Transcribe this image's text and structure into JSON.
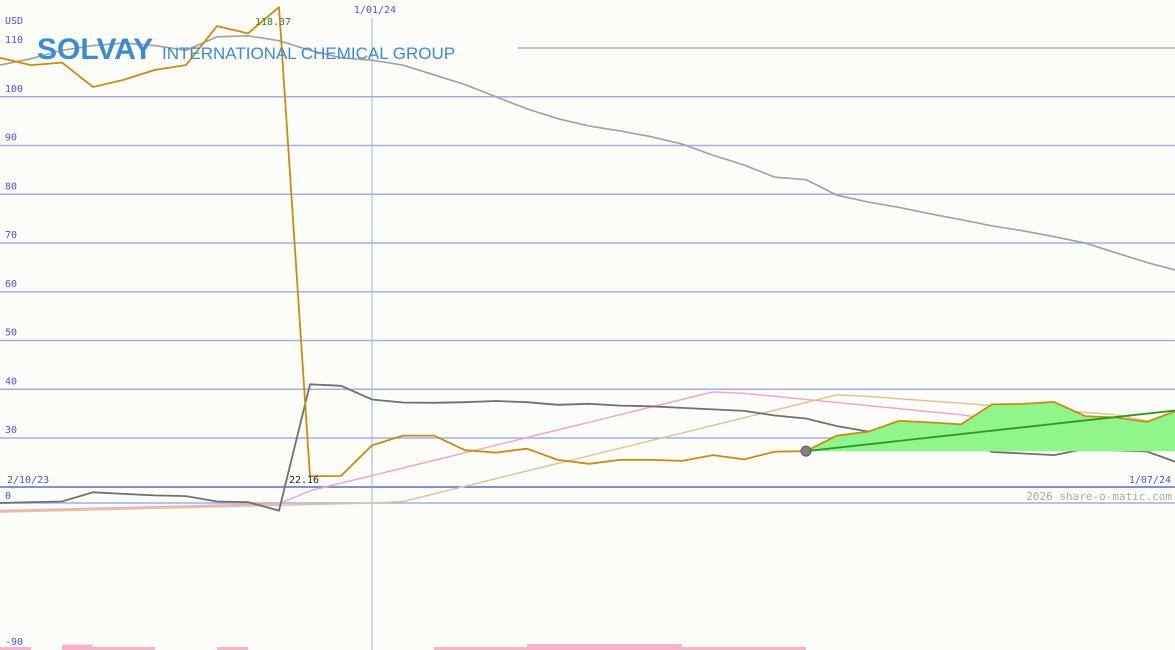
{
  "header": {
    "company": "SOLVAY",
    "subtitle": "INTERNATIONAL CHEMICAL GROUP",
    "currency": "USD",
    "credit": "2026 share-o-matic.com"
  },
  "colors": {
    "background": "#fcfdf8",
    "grid": "#9fb0e6",
    "price": "#cc8a14",
    "average": "#a0a0a0",
    "trend": "#2a9a22",
    "trend_fill": "#90f58a",
    "indicator": "#707070",
    "indicator_pink": "#f0a8c0",
    "indicator_tan": "#e0c498",
    "volume": "#f7b3ca"
  },
  "chart_data": [
    {
      "type": "line",
      "name": "price-panel",
      "ylim": [
        22,
        119
      ],
      "yticks": [
        30,
        40,
        50,
        60,
        70,
        80,
        90,
        100,
        110
      ],
      "x_start_label": "2/10/23",
      "x_end_label": "1/07/24",
      "x_marker_label": "1/01/24",
      "x_marker_index": 12,
      "peak_label": "118.37",
      "peak_index": 9,
      "trough_label": "22.16",
      "trough_index": 10,
      "series": [
        {
          "role": "price",
          "values": [
            108,
            106.5,
            107,
            102,
            103.5,
            105.5,
            106.5,
            114.5,
            113,
            118.37,
            22.16,
            22.2,
            28.5,
            30.5,
            30.5,
            27.5,
            27,
            27.8,
            25.5,
            24.7,
            25.5,
            25.5,
            25.3,
            26.5,
            25.6,
            27.2,
            27.3,
            30.5,
            31.3,
            33.5,
            33.2,
            32.8,
            36.9,
            37.0,
            37.4,
            34.5,
            34.2,
            33.3,
            35.7
          ]
        },
        {
          "role": "moving-average",
          "values": [
            106.5,
            107.8,
            109.5,
            110.5,
            111,
            110.5,
            109.5,
            112.3,
            112.5,
            111.5,
            109.5,
            108,
            107.5,
            106.5,
            104.5,
            102.5,
            100,
            97.5,
            95.5,
            94,
            93,
            91.8,
            90.3,
            88,
            86,
            83.5,
            83,
            79.8,
            78.4,
            77.3,
            76,
            74.8,
            73.5,
            72.5,
            71.3,
            70,
            68,
            66,
            64.3
          ]
        }
      ],
      "trend": {
        "start_index": 26,
        "start_value": 27.3,
        "end_value": 35.7
      }
    },
    {
      "type": "line",
      "name": "indicator-panel",
      "ylim": [
        -90,
        0
      ],
      "yticks": [
        0,
        -90
      ],
      "series": [
        {
          "role": "indicator",
          "values": [
            0,
            -0.5,
            -1,
            -7,
            -6,
            -5,
            -4.5,
            -1,
            -0.5,
            5,
            -78,
            -77,
            -68,
            -66,
            -65.8,
            -66.2,
            -67,
            -66.2,
            -64.5,
            -65.2,
            -64,
            -63.5,
            -62.5,
            -61.5,
            -60.5,
            -57.5,
            -55.5,
            -50.5,
            -47,
            -42.5,
            -42.5,
            -42.5,
            -33.5,
            -32.5,
            -31.5,
            -35.5,
            -34.5,
            -33.8,
            -26.5
          ]
        },
        {
          "role": "signal-pink",
          "values": [
            5,
            4.5,
            4,
            3.5,
            3,
            2.5,
            2,
            1.5,
            1,
            0.5,
            -8,
            -13,
            -18,
            -23,
            -28,
            -33,
            -38,
            -43,
            -48,
            -53,
            -58,
            -63,
            -68,
            -73,
            -72,
            -70,
            -68,
            -66,
            -64,
            -62,
            -60,
            -58,
            -55,
            -52,
            -49,
            -46,
            -43,
            -40,
            -37
          ]
        },
        {
          "role": "signal-tan",
          "values": [
            6,
            5.5,
            5,
            4.5,
            4,
            3.5,
            3,
            2.5,
            2,
            1.5,
            1,
            0.5,
            0,
            -1,
            -6,
            -11,
            -16,
            -21,
            -26,
            -31,
            -36,
            -41,
            -46,
            -51,
            -56,
            -61,
            -66,
            -71,
            -70,
            -68.5,
            -67,
            -65.5,
            -64,
            -62.5,
            -61,
            -59.5,
            -58,
            -54,
            -50
          ]
        }
      ],
      "volume_bars": [
        {
          "from": 0,
          "to": 1,
          "level": 0.5
        },
        {
          "from": 2,
          "to": 3,
          "level": 0.9
        },
        {
          "from": 3,
          "to": 5,
          "level": 0.5
        },
        {
          "from": 7,
          "to": 8,
          "level": 0.5
        },
        {
          "from": 14,
          "to": 17,
          "level": 0.5
        },
        {
          "from": 17,
          "to": 22,
          "level": 1.0
        },
        {
          "from": 22,
          "to": 26,
          "level": 0.5
        }
      ]
    }
  ]
}
